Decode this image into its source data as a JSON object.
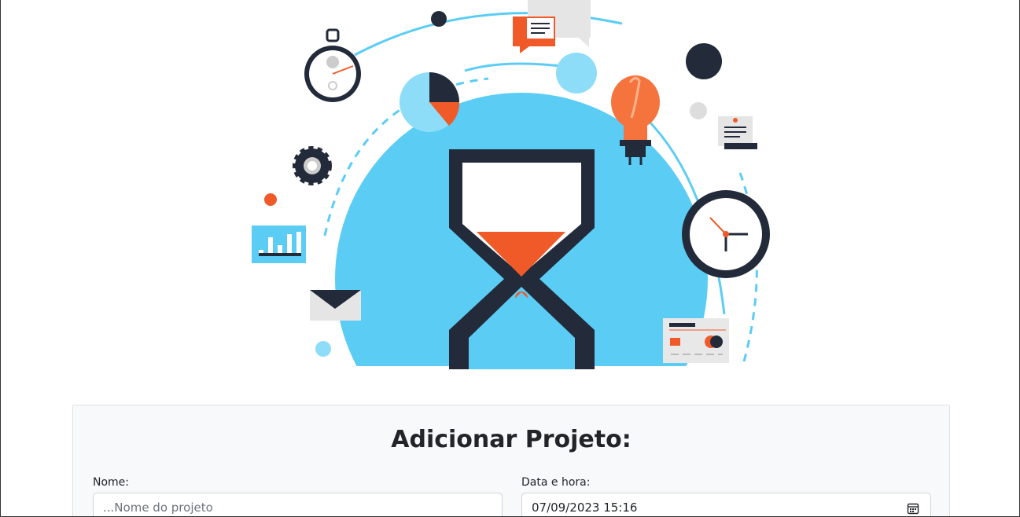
{
  "form": {
    "title": "Adicionar Projeto:",
    "name_label": "Nome:",
    "name_placeholder": "...Nome do projeto",
    "date_label": "Data e hora:",
    "date_value": "07/09/2023 15:16"
  },
  "colors": {
    "panel_bg": "#f8f9fa",
    "accent_blue": "#5bcdf5",
    "accent_orange": "#f05a28",
    "dark_navy": "#232b3a"
  },
  "icons": [
    "hourglass-icon",
    "stopwatch-icon",
    "clock-icon",
    "lightbulb-icon",
    "gear-icon",
    "envelope-icon",
    "pie-chart-icon",
    "bar-chart-icon",
    "chat-bubble-icon",
    "document-icon",
    "credit-card-icon",
    "calendar-icon"
  ]
}
